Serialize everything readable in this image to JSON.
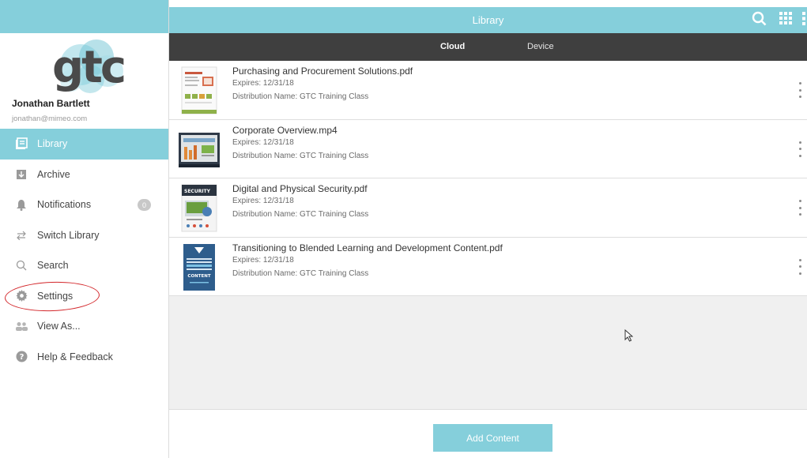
{
  "sidebar": {
    "user_name": "Jonathan Bartlett",
    "user_email": "jonathan@mimeo.com",
    "logo_text": "gtc",
    "notifications_badge": "0",
    "items": [
      {
        "label": "Library",
        "icon": "library-icon",
        "active": true
      },
      {
        "label": "Archive",
        "icon": "archive-icon"
      },
      {
        "label": "Notifications",
        "icon": "bell-icon"
      },
      {
        "label": "Switch Library",
        "icon": "switch-arrows-icon"
      },
      {
        "label": "Search",
        "icon": "search-icon"
      },
      {
        "label": "Settings",
        "icon": "gear-icon"
      },
      {
        "label": "View As...",
        "icon": "users-icon"
      },
      {
        "label": "Help & Feedback",
        "icon": "help-icon"
      }
    ]
  },
  "header": {
    "title": "Library",
    "icons": [
      "search-icon",
      "apps-grid-icon",
      "more-vertical-icon"
    ]
  },
  "tabs": [
    {
      "label": "Cloud",
      "active": true
    },
    {
      "label": "Device",
      "active": false
    }
  ],
  "documents": [
    {
      "title": "Purchasing and Procurement Solutions.pdf",
      "expires": "Expires: 12/31/18",
      "distribution": "Distribution Name: GTC Training Class"
    },
    {
      "title": "Corporate Overview.mp4",
      "expires": "Expires: 12/31/18",
      "distribution": "Distribution Name: GTC Training Class"
    },
    {
      "title": "Digital and Physical Security.pdf",
      "expires": "Expires: 12/31/18",
      "distribution": "Distribution Name: GTC Training Class",
      "thumb_text": "SECURITY"
    },
    {
      "title": "Transitioning to Blended Learning and Development Content.pdf",
      "expires": "Expires: 12/31/18",
      "distribution": "Distribution Name: GTC Training Class",
      "thumb_text": "CONTENT"
    }
  ],
  "footer": {
    "add_button_label": "Add Content"
  },
  "colors": {
    "accent": "#85cfdb",
    "tab_bar": "#3f3f3f",
    "annotation": "#d3272b"
  }
}
